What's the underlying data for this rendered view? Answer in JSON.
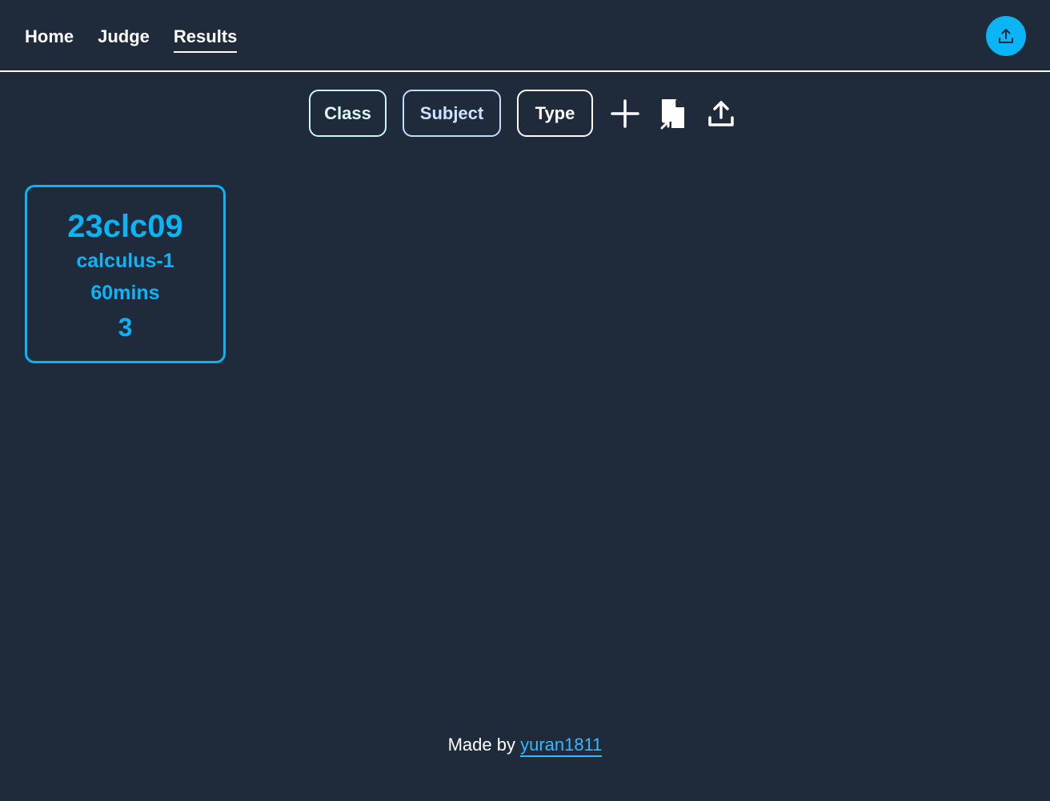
{
  "nav": {
    "items": [
      {
        "label": "Home"
      },
      {
        "label": "Judge"
      },
      {
        "label": "Results"
      }
    ],
    "active": "Results"
  },
  "header": {
    "upload_icon": "upload-icon"
  },
  "toolbar": {
    "class_label": "Class",
    "subject_label": "Subject",
    "type_label": "Type",
    "icons": [
      "plus-icon",
      "file-export-icon",
      "upload-icon"
    ]
  },
  "cards": [
    {
      "class": "23clc09",
      "subject": "calculus-1",
      "duration": "60mins",
      "count": "3"
    }
  ],
  "footer": {
    "prefix": "Made by",
    "author": "yuran1811"
  },
  "colors": {
    "background": "#1f2a3b",
    "accent": "#0ab4f5",
    "link": "#38b7ff"
  }
}
